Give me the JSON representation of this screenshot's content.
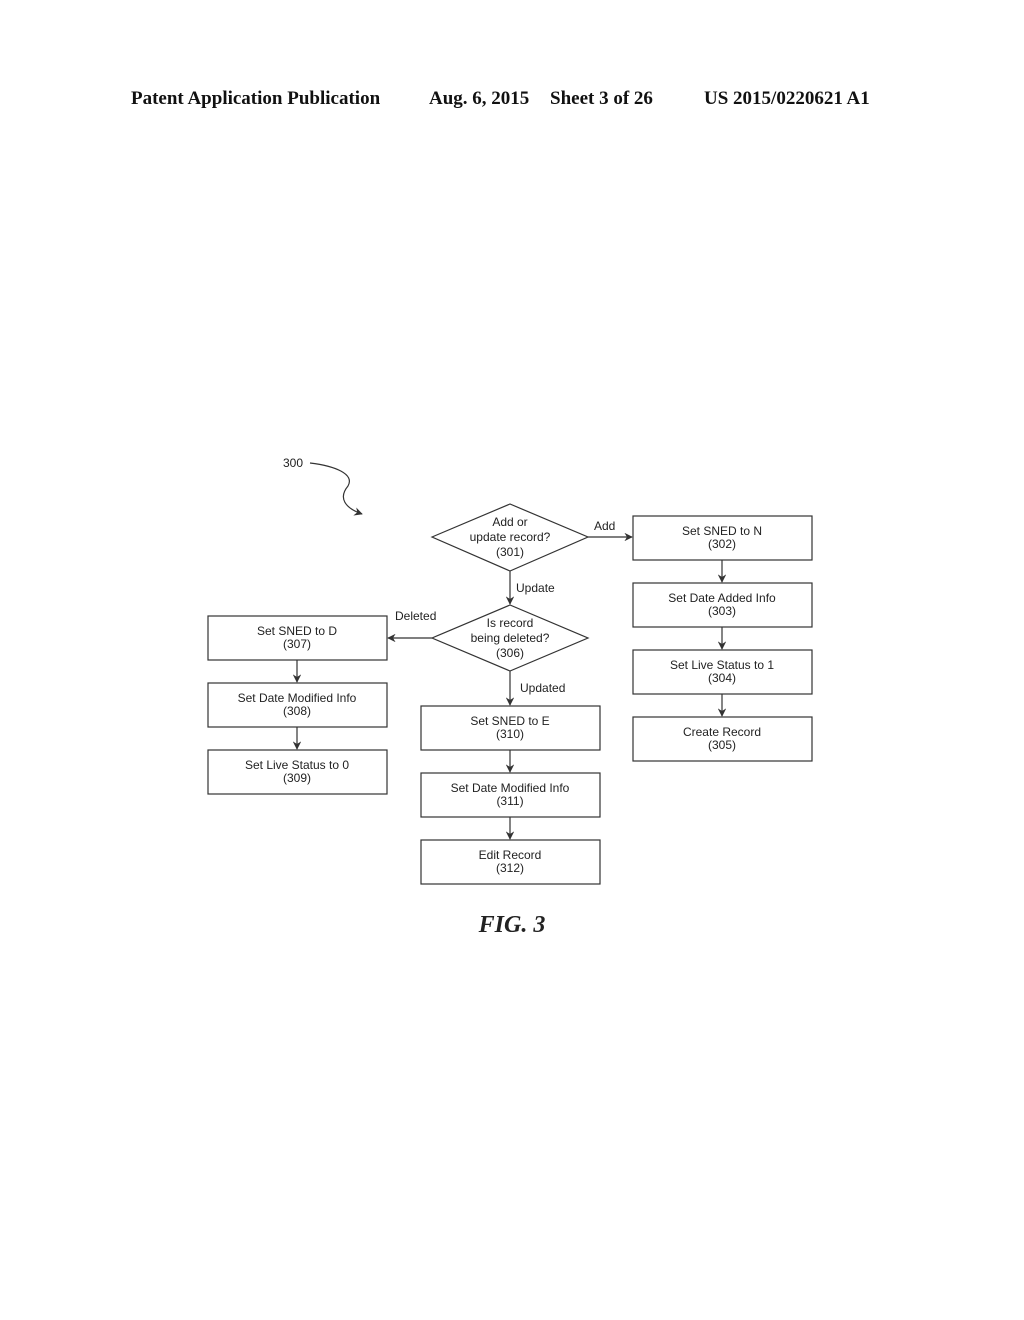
{
  "header": {
    "publication": "Patent Application Publication",
    "date": "Aug. 6, 2015",
    "sheet": "Sheet 3 of 26",
    "patent_number": "US 2015/0220621 A1"
  },
  "figure": {
    "reference": "300",
    "caption": "FIG. 3"
  },
  "nodes": {
    "n301": {
      "type": "decision",
      "lines": [
        "Add or",
        "update record?",
        "(301)"
      ]
    },
    "n302": {
      "type": "process",
      "lines": [
        "Set SNED to N",
        "(302)"
      ]
    },
    "n303": {
      "type": "process",
      "lines": [
        "Set Date Added Info",
        "(303)"
      ]
    },
    "n304": {
      "type": "process",
      "lines": [
        "Set Live Status to 1",
        "(304)"
      ]
    },
    "n305": {
      "type": "process",
      "lines": [
        "Create Record",
        "(305)"
      ]
    },
    "n306": {
      "type": "decision",
      "lines": [
        "Is record",
        "being deleted?",
        "(306)"
      ]
    },
    "n307": {
      "type": "process",
      "lines": [
        "Set SNED to D",
        "(307)"
      ]
    },
    "n308": {
      "type": "process",
      "lines": [
        "Set Date Modified Info",
        "(308)"
      ]
    },
    "n309": {
      "type": "process",
      "lines": [
        "Set Live Status to 0",
        "(309)"
      ]
    },
    "n310": {
      "type": "process",
      "lines": [
        "Set SNED to E",
        "(310)"
      ]
    },
    "n311": {
      "type": "process",
      "lines": [
        "Set Date Modified Info",
        "(311)"
      ]
    },
    "n312": {
      "type": "process",
      "lines": [
        "Edit Record",
        "(312)"
      ]
    }
  },
  "edges": {
    "add": "Add",
    "update": "Update",
    "deleted": "Deleted",
    "updated": "Updated"
  }
}
